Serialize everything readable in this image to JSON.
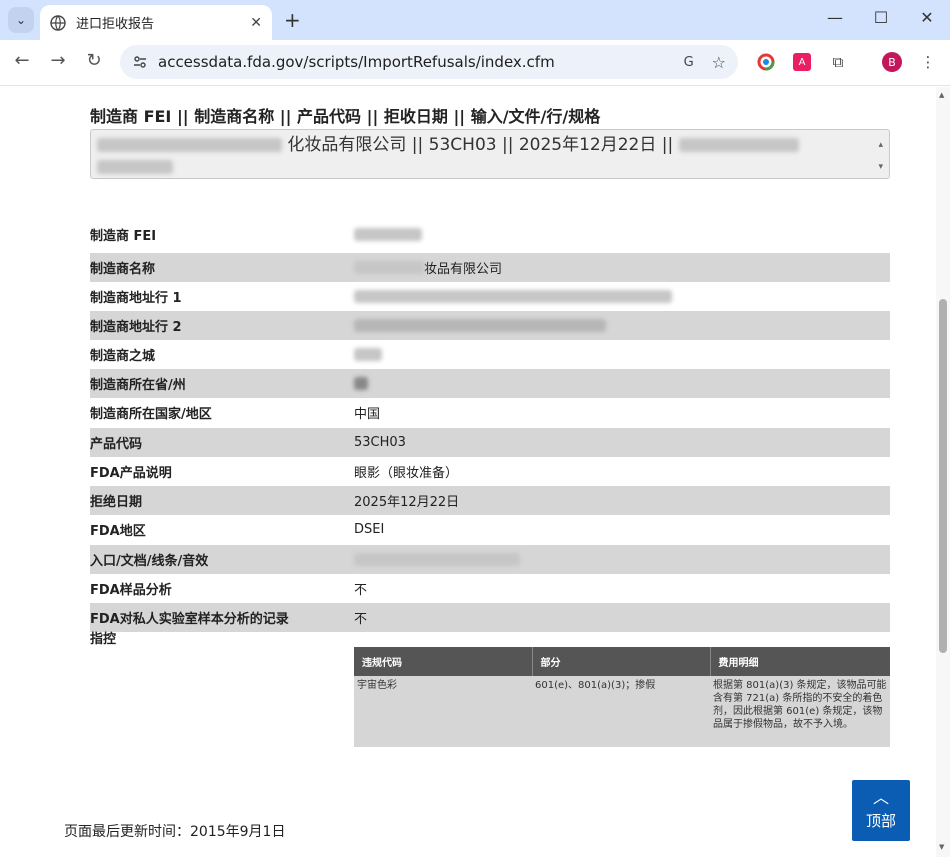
{
  "browser": {
    "tab_title": "进口拒收报告",
    "tab_close": "✕",
    "new_tab": "+",
    "url": "accessdata.fda.gov/scripts/ImportRefusals/index.cfm",
    "avatar_letter": "B",
    "window_controls": {
      "minimize": "—",
      "maximize": "☐",
      "close": "✕"
    }
  },
  "selector": {
    "label": "制造商 FEI || 制造商名称 || 产品代码 || 拒收日期 || 输入/文件/行/规格",
    "visible_text": "化妆品有限公司 || 53CH03 || 2025年12月22日 ||"
  },
  "details": [
    {
      "label": "制造商 FEI",
      "value": ""
    },
    {
      "label": "制造商名称",
      "value": "妆品有限公司"
    },
    {
      "label": "制造商地址行 1",
      "value": ""
    },
    {
      "label": "制造商地址行 2",
      "value": ""
    },
    {
      "label": "制造商之城",
      "value": ""
    },
    {
      "label": "制造商所在省/州",
      "value": ""
    },
    {
      "label": "制造商所在国家/地区",
      "value": "中国"
    },
    {
      "label": "产品代码",
      "value": "53CH03"
    },
    {
      "label": "FDA产品说明",
      "value": "眼影（眼妆准备）"
    },
    {
      "label": "拒绝日期",
      "value": "2025年12月22日"
    },
    {
      "label": "FDA地区",
      "value": "DSEI"
    },
    {
      "label": "入口/文档/线条/音效",
      "value": ""
    },
    {
      "label": "FDA样品分析",
      "value": "不"
    },
    {
      "label": "FDA对私人实验室样本分析的记录",
      "value": "不"
    },
    {
      "label": "指控",
      "value": ""
    }
  ],
  "charges_table": {
    "headers": [
      "违规代码",
      "部分",
      "费用明细"
    ],
    "rows": [
      [
        "宇宙色彩",
        "601(e)、801(a)(3)；掺假",
        "根据第 801(a)(3) 条规定，该物品可能含有第 721(a) 条所指的不安全的着色剂，因此根据第 601(e) 条规定，该物品属于掺假物品，故不予入境。"
      ]
    ]
  },
  "footer": {
    "last_updated": "页面最后更新时间：2015年9月1日",
    "top_button": "顶部",
    "top_caret": "︿"
  }
}
